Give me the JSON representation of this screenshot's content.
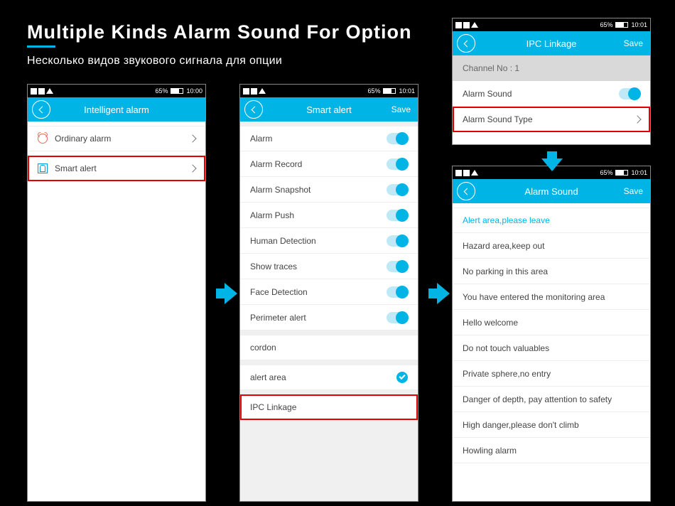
{
  "title": {
    "main": "Multiple Kinds Alarm Sound For Option",
    "sub": "Несколько видов звукового сигнала для опции"
  },
  "status": {
    "battery": "65%",
    "time1": "10:00",
    "time2": "10:01"
  },
  "phone1": {
    "title": "Intelligent alarm",
    "rows": [
      {
        "label": "Ordinary alarm",
        "icon": "alarm"
      },
      {
        "label": "Smart alert",
        "icon": "smart",
        "highlighted": true
      }
    ]
  },
  "phone2": {
    "title": "Smart alert",
    "save": "Save",
    "rows": [
      {
        "label": "Alarm",
        "toggle": true
      },
      {
        "label": "Alarm Record",
        "toggle": true
      },
      {
        "label": "Alarm Snapshot",
        "toggle": true
      },
      {
        "label": "Alarm Push",
        "toggle": true
      },
      {
        "label": "Human Detection",
        "toggle": true
      },
      {
        "label": "Show traces",
        "toggle": true
      },
      {
        "label": "Face Detection",
        "toggle": true
      },
      {
        "label": "Perimeter alert",
        "toggle": true
      },
      {
        "label": "cordon"
      },
      {
        "label": "alert area",
        "check": true
      },
      {
        "label": "IPC Linkage",
        "highlighted": true
      }
    ]
  },
  "phone3": {
    "title": "IPC Linkage",
    "save": "Save",
    "channel_label": "Channel No : 1",
    "rows": [
      {
        "label": "Alarm Sound",
        "toggle": true
      },
      {
        "label": "Alarm Sound Type",
        "chev": true,
        "highlighted": true
      }
    ]
  },
  "phone4": {
    "title": "Alarm Sound",
    "save": "Save",
    "rows": [
      {
        "label": "Alert area,please leave",
        "selected": true
      },
      {
        "label": "Hazard area,keep out"
      },
      {
        "label": "No parking in this area"
      },
      {
        "label": "You have entered the monitoring area"
      },
      {
        "label": "Hello welcome"
      },
      {
        "label": "Do not touch valuables"
      },
      {
        "label": "Private sphere,no entry"
      },
      {
        "label": "Danger of depth, pay attention to safety"
      },
      {
        "label": "High danger,please don't climb"
      },
      {
        "label": "Howling alarm"
      }
    ]
  }
}
